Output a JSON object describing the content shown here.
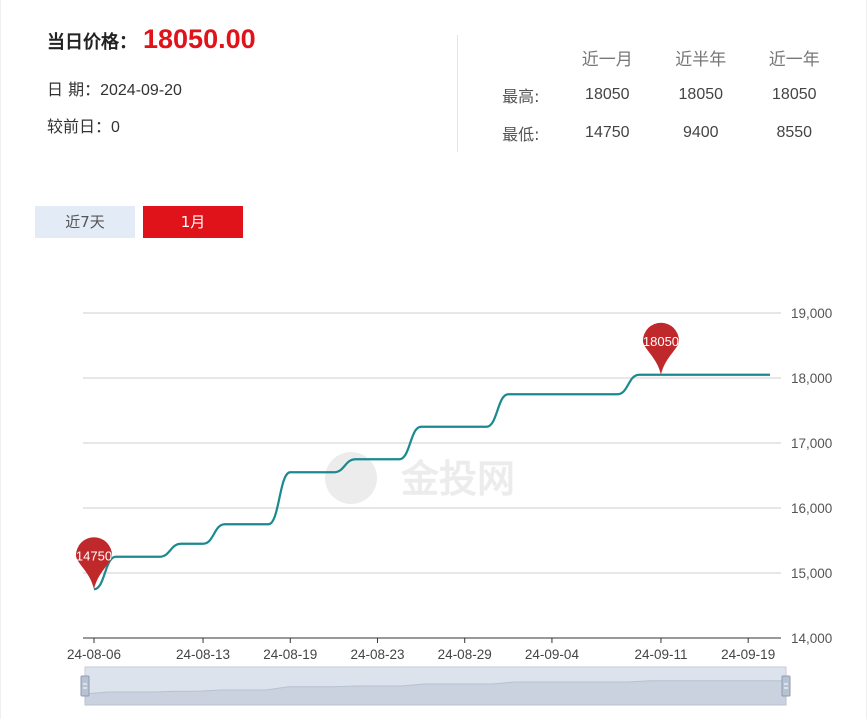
{
  "header": {
    "price_label": "当日价格：",
    "price_value": "18050.00",
    "date_label": "日 期：",
    "date_value": "2024-09-20",
    "change_label": "较前日：",
    "change_value": "0"
  },
  "stats": {
    "columns": [
      "近一月",
      "近半年",
      "近一年"
    ],
    "rows": [
      {
        "label": "最高:",
        "values": [
          "18050",
          "18050",
          "18050"
        ]
      },
      {
        "label": "最低:",
        "values": [
          "14750",
          "9400",
          "8550"
        ]
      }
    ]
  },
  "tabs": [
    {
      "label": "近7天",
      "active": false
    },
    {
      "label": "1月",
      "active": true
    }
  ],
  "watermark": "金投网",
  "chart_data": {
    "type": "line",
    "x": [
      "24-08-06",
      "24-08-07",
      "24-08-08",
      "24-08-09",
      "24-08-12",
      "24-08-13",
      "24-08-14",
      "24-08-15",
      "24-08-16",
      "24-08-19",
      "24-08-20",
      "24-08-21",
      "24-08-22",
      "24-08-23",
      "24-08-26",
      "24-08-27",
      "24-08-28",
      "24-08-29",
      "24-08-30",
      "24-09-02",
      "24-09-03",
      "24-09-04",
      "24-09-05",
      "24-09-06",
      "24-09-09",
      "24-09-10",
      "24-09-11",
      "24-09-12",
      "24-09-13",
      "24-09-18",
      "24-09-19",
      "24-09-20"
    ],
    "values": [
      14750,
      15250,
      15250,
      15250,
      15450,
      15450,
      15750,
      15750,
      15750,
      16550,
      16550,
      16550,
      16750,
      16750,
      16750,
      17250,
      17250,
      17250,
      17250,
      17750,
      17750,
      17750,
      17750,
      17750,
      17750,
      18050,
      18050,
      18050,
      18050,
      18050,
      18050,
      18050
    ],
    "xticks": [
      "24-08-06",
      "24-08-13",
      "24-08-19",
      "24-08-23",
      "24-08-29",
      "24-09-04",
      "24-09-11",
      "24-09-19"
    ],
    "yticks": [
      "14,000",
      "15,000",
      "16,000",
      "17,000",
      "18,000",
      "19,000"
    ],
    "ylim": [
      14000,
      19000
    ],
    "line_color": "#1a8a8e",
    "marker_color": "#c0292b",
    "markers": [
      {
        "label": "14750",
        "x": "24-08-06",
        "value": 14750
      },
      {
        "label": "18050",
        "x": "24-09-11",
        "value": 18050
      }
    ],
    "grid": true
  }
}
